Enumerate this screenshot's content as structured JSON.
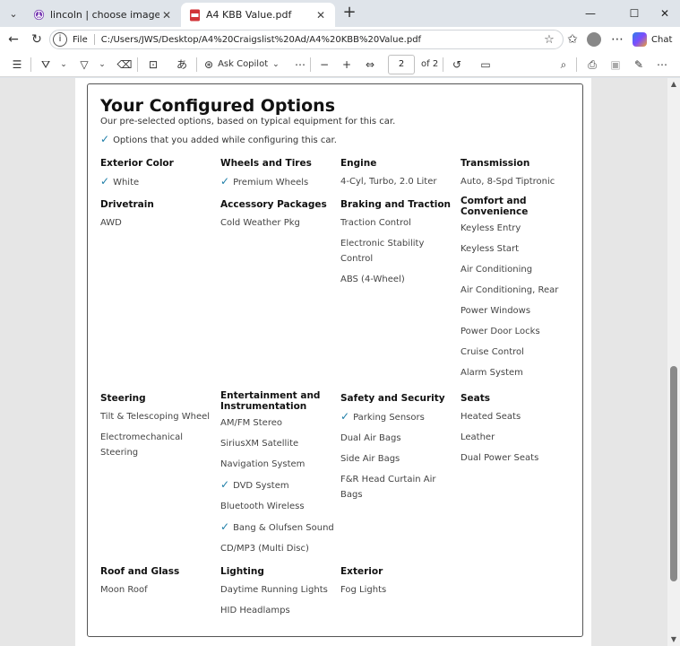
{
  "browser": {
    "tabs": [
      {
        "label": "lincoln | choose images",
        "icon": "peace-sign-icon",
        "active": false
      },
      {
        "label": "A4 KBB Value.pdf",
        "icon": "pdf-icon",
        "active": true
      }
    ],
    "address": {
      "scheme_label": "File",
      "url": "C:/Users/JWS/Desktop/A4%20Craigslist%20Ad/A4%20KBB%20Value.pdf"
    },
    "chat_label": "Chat"
  },
  "pdf_toolbar": {
    "copilot_label": "Ask Copilot",
    "page_current": "2",
    "page_total_label": "of 2"
  },
  "document": {
    "title": "Your Configured Options",
    "subtitle": "Our pre-selected options, based on typical equipment for this car.",
    "legend": "Options that you added while configuring this car.",
    "categories": [
      {
        "title": "Exterior Color",
        "items": [
          {
            "label": "White",
            "checked": true
          }
        ]
      },
      {
        "title": "Wheels and Tires",
        "items": [
          {
            "label": "Premium Wheels",
            "checked": true
          }
        ]
      },
      {
        "title": "Engine",
        "items": [
          {
            "label": "4-Cyl, Turbo, 2.0 Liter",
            "checked": false
          }
        ]
      },
      {
        "title": "Transmission",
        "items": [
          {
            "label": "Auto, 8-Spd Tiptronic",
            "checked": false
          }
        ]
      },
      {
        "title": "Drivetrain",
        "items": [
          {
            "label": "AWD",
            "checked": false
          }
        ]
      },
      {
        "title": "Accessory Packages",
        "items": [
          {
            "label": "Cold Weather Pkg",
            "checked": false
          }
        ]
      },
      {
        "title": "Braking and Traction",
        "items": [
          {
            "label": "Traction Control",
            "checked": false
          },
          {
            "label": "Electronic Stability Control",
            "checked": false
          },
          {
            "label": "ABS (4-Wheel)",
            "checked": false
          }
        ]
      },
      {
        "title": "Comfort and Convenience",
        "items": [
          {
            "label": "Keyless Entry",
            "checked": false
          },
          {
            "label": "Keyless Start",
            "checked": false
          },
          {
            "label": "Air Conditioning",
            "checked": false
          },
          {
            "label": "Air Conditioning, Rear",
            "checked": false
          },
          {
            "label": "Power Windows",
            "checked": false
          },
          {
            "label": "Power Door Locks",
            "checked": false
          },
          {
            "label": "Cruise Control",
            "checked": false
          },
          {
            "label": "Alarm System",
            "checked": false
          }
        ]
      },
      {
        "title": "Steering",
        "items": [
          {
            "label": "Tilt & Telescoping Wheel",
            "checked": false
          },
          {
            "label": "Electromechanical Steering",
            "checked": false
          }
        ]
      },
      {
        "title": "Entertainment and Instrumentation",
        "items": [
          {
            "label": "AM/FM Stereo",
            "checked": false
          },
          {
            "label": "SiriusXM Satellite",
            "checked": false
          },
          {
            "label": "Navigation System",
            "checked": false
          },
          {
            "label": "DVD System",
            "checked": true
          },
          {
            "label": "Bluetooth Wireless",
            "checked": false
          },
          {
            "label": "Bang & Olufsen Sound",
            "checked": true
          },
          {
            "label": "CD/MP3 (Multi Disc)",
            "checked": false
          }
        ]
      },
      {
        "title": "Safety and Security",
        "items": [
          {
            "label": "Parking Sensors",
            "checked": true
          },
          {
            "label": "Dual Air Bags",
            "checked": false
          },
          {
            "label": "Side Air Bags",
            "checked": false
          },
          {
            "label": "F&R Head Curtain Air Bags",
            "checked": false
          }
        ]
      },
      {
        "title": "Seats",
        "items": [
          {
            "label": "Heated Seats",
            "checked": false
          },
          {
            "label": "Leather",
            "checked": false
          },
          {
            "label": "Dual Power Seats",
            "checked": false
          }
        ]
      },
      {
        "title": "Roof and Glass",
        "items": [
          {
            "label": "Moon Roof",
            "checked": false
          }
        ]
      },
      {
        "title": "Lighting",
        "items": [
          {
            "label": "Daytime Running Lights",
            "checked": false
          },
          {
            "label": "HID Headlamps",
            "checked": false
          }
        ]
      },
      {
        "title": "Exterior",
        "items": [
          {
            "label": "Fog Lights",
            "checked": false
          }
        ]
      }
    ]
  },
  "colors": {
    "check": "#1e7ea8",
    "accent": "#0067c0"
  }
}
